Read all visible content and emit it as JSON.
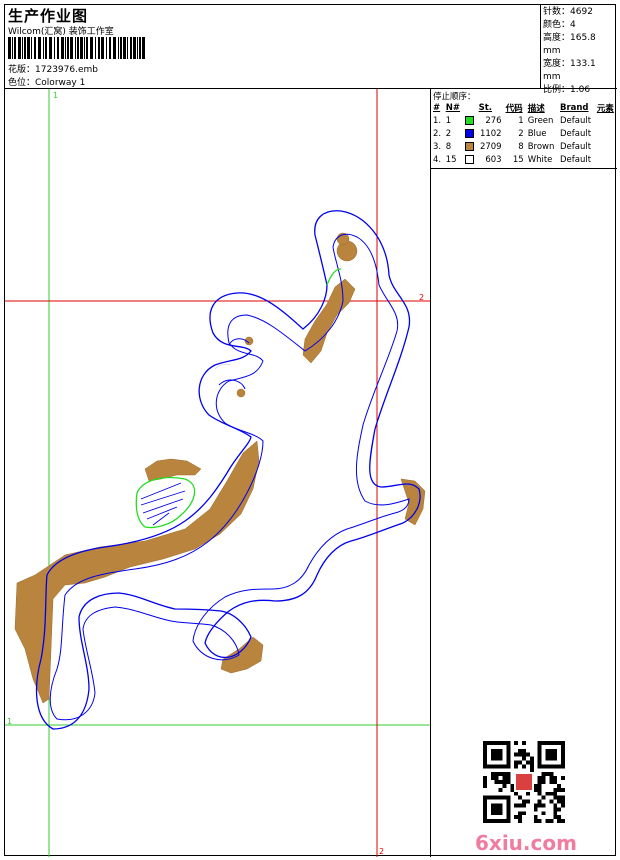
{
  "header": {
    "title": "生产作业图",
    "company": "Wilcom(汇窝) 装饰工作室",
    "design_label": "花版：",
    "design_value": "1723976.emb",
    "colorway_label": "色位：",
    "colorway_value": "Colorway 1"
  },
  "stats": [
    {
      "label": "针数：",
      "value": "4692"
    },
    {
      "label": "颜色：",
      "value": "4"
    },
    {
      "label": "高度：",
      "value": "165.8 mm"
    },
    {
      "label": "宽度：",
      "value": "133.1 mm"
    },
    {
      "label": "比例：",
      "value": "1.06"
    }
  ],
  "stop_sequence": {
    "caption": "停止顺序：",
    "headers": [
      "#",
      "N#",
      "St.",
      "代码",
      "描述",
      "Brand",
      "元素"
    ],
    "rows": [
      {
        "n": "1.",
        "needle": "1",
        "color": "#22dd22",
        "st": "276",
        "code": "1",
        "desc": "Green",
        "brand": "Default",
        "elem": ""
      },
      {
        "n": "2.",
        "needle": "2",
        "color": "#0000ee",
        "st": "1102",
        "code": "2",
        "desc": "Blue",
        "brand": "Default",
        "elem": ""
      },
      {
        "n": "3.",
        "needle": "8",
        "color": "#b8843e",
        "st": "2709",
        "code": "8",
        "desc": "Brown",
        "brand": "Default",
        "elem": ""
      },
      {
        "n": "4.",
        "needle": "15",
        "color": "#ffffff",
        "st": "603",
        "code": "15",
        "desc": "White",
        "brand": "Default",
        "elem": ""
      }
    ]
  },
  "markers": {
    "v1": "1",
    "h1": "1",
    "h2": "2",
    "v2": "2"
  },
  "colors": {
    "green": "#22dd22",
    "blue": "#0000ee",
    "brown": "#b8843e",
    "red": "#e00000",
    "guide_green": "#33cc33"
  },
  "watermark": "6xiu.com"
}
